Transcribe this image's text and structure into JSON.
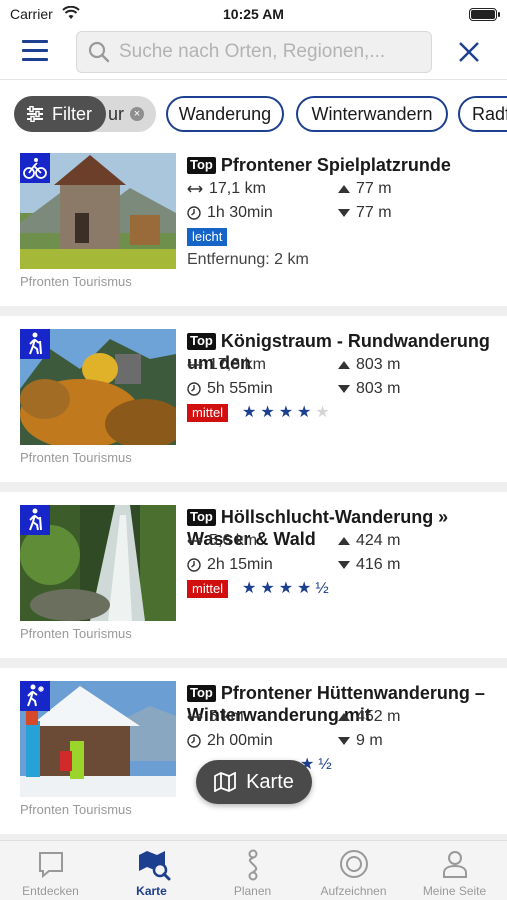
{
  "status_bar": {
    "carrier": "Carrier",
    "time": "10:25 AM"
  },
  "search": {
    "placeholder": "Suche nach Orten, Regionen,..."
  },
  "filter_label": "Filter",
  "chips": [
    {
      "label": "ur",
      "selected": true
    },
    {
      "label": "Wanderung"
    },
    {
      "label": "Winterwandern"
    },
    {
      "label": "Radf"
    }
  ],
  "top_label": "Top",
  "tours": [
    {
      "title": "Pfrontener Spielplatzrunde",
      "category_icon": "cycling-icon",
      "distance": "17,1 km",
      "duration": "1h 30min",
      "ascent": "77 m",
      "descent": "77 m",
      "difficulty": "leicht",
      "difficulty_color": "#1565c8",
      "proximity": "Entfernung: 2 km",
      "source": "Pfronten Tourismus"
    },
    {
      "title": "Königstraum - Rundwanderung um den",
      "category_icon": "hiking-icon",
      "distance": "17,8 km",
      "duration": "5h 55min",
      "ascent": "803 m",
      "descent": "803 m",
      "difficulty": "mittel",
      "difficulty_color": "#d20f0f",
      "rating": 4,
      "source": "Pfronten Tourismus"
    },
    {
      "title": "Höllschlucht-Wanderung » Wasser & Wald",
      "category_icon": "hiking-icon",
      "distance": "5,6 km",
      "duration": "2h 15min",
      "ascent": "424 m",
      "descent": "416 m",
      "difficulty": "mittel",
      "difficulty_color": "#d20f0f",
      "rating": 4.5,
      "source": "Pfronten Tourismus"
    },
    {
      "title": "Pfrontener Hüttenwanderung – Winterwanderung mit",
      "category_icon": "winter-hiking-icon",
      "distance": "5 km",
      "duration": "2h 00min",
      "ascent": "452 m",
      "descent": "9 m",
      "rating": 4.5,
      "source": "Pfronten Tourismus"
    }
  ],
  "map_button": {
    "label": "Karte"
  },
  "tabs": [
    {
      "label": "Entdecken",
      "icon": "chat-bubble-icon"
    },
    {
      "label": "Karte",
      "icon": "map-search-icon",
      "active": true
    },
    {
      "label": "Planen",
      "icon": "route-icon"
    },
    {
      "label": "Aufzeichnen",
      "icon": "record-icon"
    },
    {
      "label": "Meine Seite",
      "icon": "profile-icon"
    }
  ],
  "colors": {
    "primary": "#1d3f8f",
    "category_badge": "#1726c8",
    "tab_inactive": "#999999"
  }
}
